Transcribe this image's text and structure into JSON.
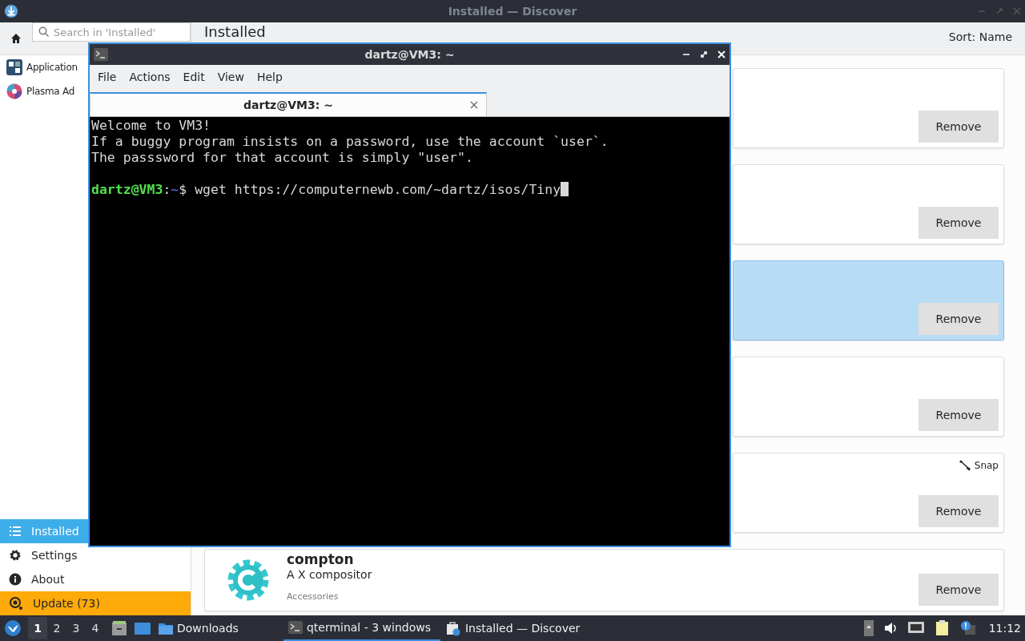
{
  "discover": {
    "title": "Installed — Discover",
    "search": {
      "placeholder": "Search in 'Installed'"
    },
    "heading": "Installed",
    "sort": "Sort: Name",
    "sidebar": {
      "categories": [
        {
          "label": "Application",
          "kind": "apps"
        },
        {
          "label": "Plasma Ad",
          "kind": "addons"
        }
      ],
      "items": [
        {
          "label": "Installed",
          "kind": "list",
          "selected": true
        },
        {
          "label": "Settings",
          "kind": "settings",
          "selected": false
        },
        {
          "label": "About",
          "kind": "about",
          "selected": false
        },
        {
          "label": "Update (73)",
          "kind": "update",
          "selected": false
        }
      ]
    },
    "cards": [
      {
        "selected": false,
        "button": "Remove"
      },
      {
        "selected": false,
        "button": "Remove"
      },
      {
        "selected": true,
        "button": "Remove"
      },
      {
        "selected": false,
        "button": "Remove"
      },
      {
        "selected": false,
        "source": "Snap",
        "button": "Remove"
      },
      {
        "selected": false,
        "name": "compton",
        "description": "A X compositor",
        "category": "Accessories",
        "button": "Remove"
      }
    ]
  },
  "terminal": {
    "title": "dartz@VM3: ~",
    "menu": [
      "File",
      "Actions",
      "Edit",
      "View",
      "Help"
    ],
    "tab": "dartz@VM3: ~",
    "lines": [
      "Welcome to VM3!",
      "If a buggy program insists on a password, use the account `user`.",
      "The passsword for that account is simply \"user\"."
    ],
    "prompt": {
      "user": "dartz@VM3",
      "separator": ":",
      "path": "~",
      "symbol": "$",
      "command": "wget https://computernewb.com/~dartz/isos/Tiny"
    }
  },
  "taskbar": {
    "desktops": [
      {
        "label": "1",
        "selected": true
      },
      {
        "label": "2",
        "selected": false
      },
      {
        "label": "3",
        "selected": false
      },
      {
        "label": "4",
        "selected": false
      }
    ],
    "folder": "Downloads",
    "tasks": [
      {
        "label": "qterminal - 3 windows",
        "kind": "terminal",
        "selected": true
      },
      {
        "label": "Installed — Discover",
        "kind": "discover",
        "selected": false
      }
    ],
    "clock": "11:12"
  }
}
